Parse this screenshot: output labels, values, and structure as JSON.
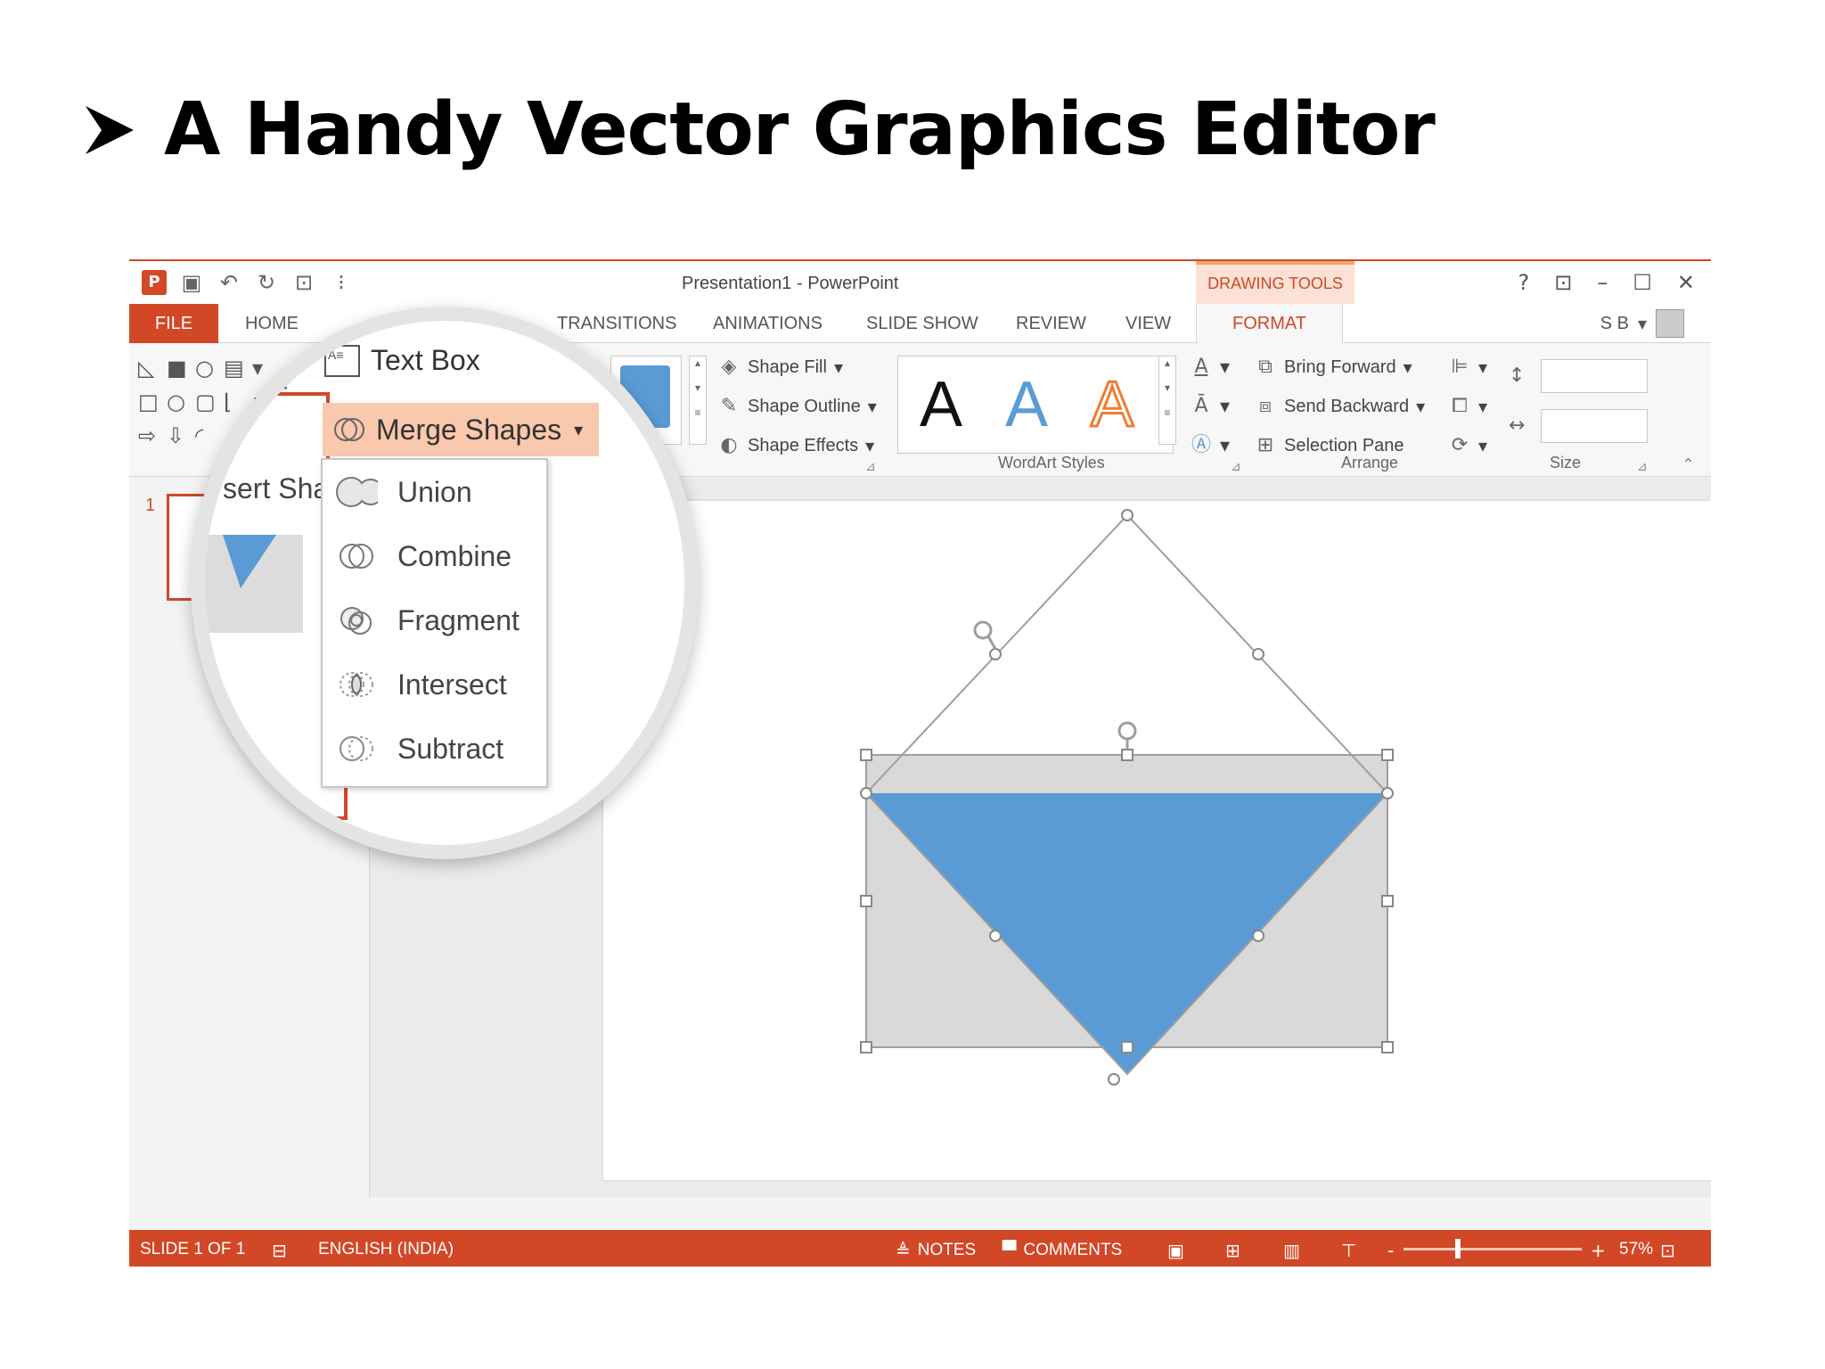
{
  "slide": {
    "title": "A Handy Vector Graphics Editor"
  },
  "window": {
    "title": "Presentation1 - PowerPoint",
    "contextual_tab_group": "DRAWING TOOLS",
    "help": "?",
    "user": "S B"
  },
  "tabs": [
    {
      "label": "FILE"
    },
    {
      "label": "HOME"
    },
    {
      "label": "TRANSITIONS"
    },
    {
      "label": "ANIMATIONS"
    },
    {
      "label": "SLIDE SHOW"
    },
    {
      "label": "REVIEW"
    },
    {
      "label": "VIEW"
    },
    {
      "label": "FORMAT"
    }
  ],
  "ribbon": {
    "shape_styles": {
      "fill": "Shape Fill",
      "outline": "Shape Outline",
      "effects": "Shape Effects"
    },
    "wordart": {
      "sample": "A",
      "label": "WordArt Styles"
    },
    "arrange": {
      "bring_forward": "Bring Forward",
      "send_backward": "Send Backward",
      "selection_pane": "Selection Pane",
      "label": "Arrange"
    },
    "size": {
      "label": "Size"
    }
  },
  "magnifier": {
    "text_box": "Text Box",
    "merge_shapes": "Merge Shapes",
    "insert_shapes_partial": "sert Sha",
    "menu": [
      {
        "label": "Union",
        "icon": "union-icon"
      },
      {
        "label": "Combine",
        "icon": "combine-icon"
      },
      {
        "label": "Fragment",
        "icon": "fragment-icon"
      },
      {
        "label": "Intersect",
        "icon": "intersect-icon"
      },
      {
        "label": "Subtract",
        "icon": "subtract-icon"
      }
    ]
  },
  "thumbnails": {
    "slide_number": "1"
  },
  "status": {
    "slide": "SLIDE 1 OF 1",
    "language": "ENGLISH (INDIA)",
    "notes": "NOTES",
    "comments": "COMMENTS",
    "zoom": "57%"
  },
  "colors": {
    "accent": "#d24726",
    "shape_fill": "#5b9bd5",
    "rect_fill": "#d9d9d9"
  }
}
